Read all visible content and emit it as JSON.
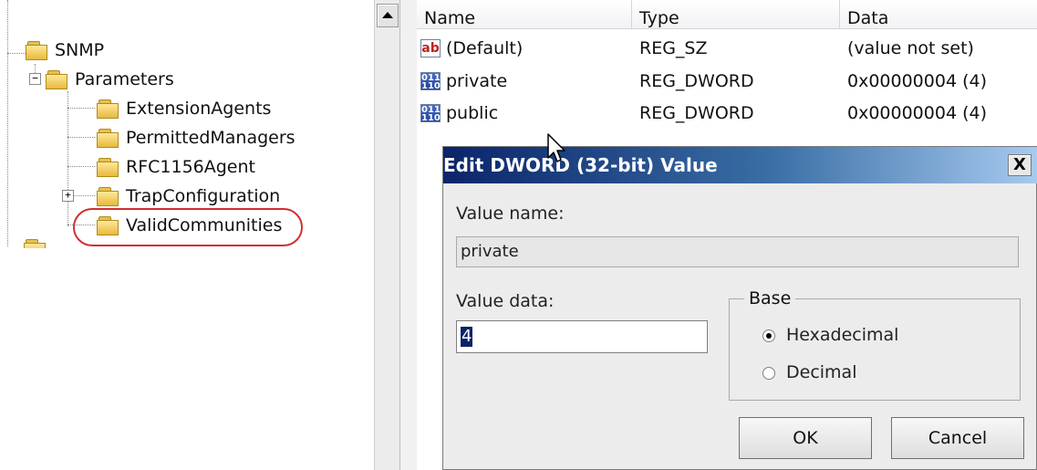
{
  "tree": {
    "items": [
      {
        "label": "SNMP"
      },
      {
        "label": "Parameters",
        "expander": "−"
      },
      {
        "label": "ExtensionAgents"
      },
      {
        "label": "PermittedManagers"
      },
      {
        "label": "RFC1156Agent"
      },
      {
        "label": "TrapConfiguration",
        "expander": "+"
      },
      {
        "label": "ValidCommunities",
        "highlighted": true
      }
    ],
    "highlight_color": "#d03030"
  },
  "list": {
    "columns": [
      "Name",
      "Type",
      "Data"
    ],
    "rows": [
      {
        "icon": "ab",
        "name": "(Default)",
        "type": "REG_SZ",
        "data": "(value not set)"
      },
      {
        "icon": "011\n110",
        "name": "private",
        "type": "REG_DWORD",
        "data": "0x00000004 (4)"
      },
      {
        "icon": "011\n110",
        "name": "public",
        "type": "REG_DWORD",
        "data": "0x00000004 (4)"
      }
    ]
  },
  "dialog": {
    "title": "Edit DWORD (32-bit) Value",
    "close_label": "X",
    "value_name_label": "Value name:",
    "value_name": "private",
    "value_data_label": "Value data:",
    "value_data": "4",
    "base_label": "Base",
    "radio_hex": "Hexadecimal",
    "radio_dec": "Decimal",
    "selected_base": "Hexadecimal",
    "ok_label": "OK",
    "cancel_label": "Cancel",
    "title_gradient": [
      "#0b246a",
      "#a6caf0"
    ]
  }
}
